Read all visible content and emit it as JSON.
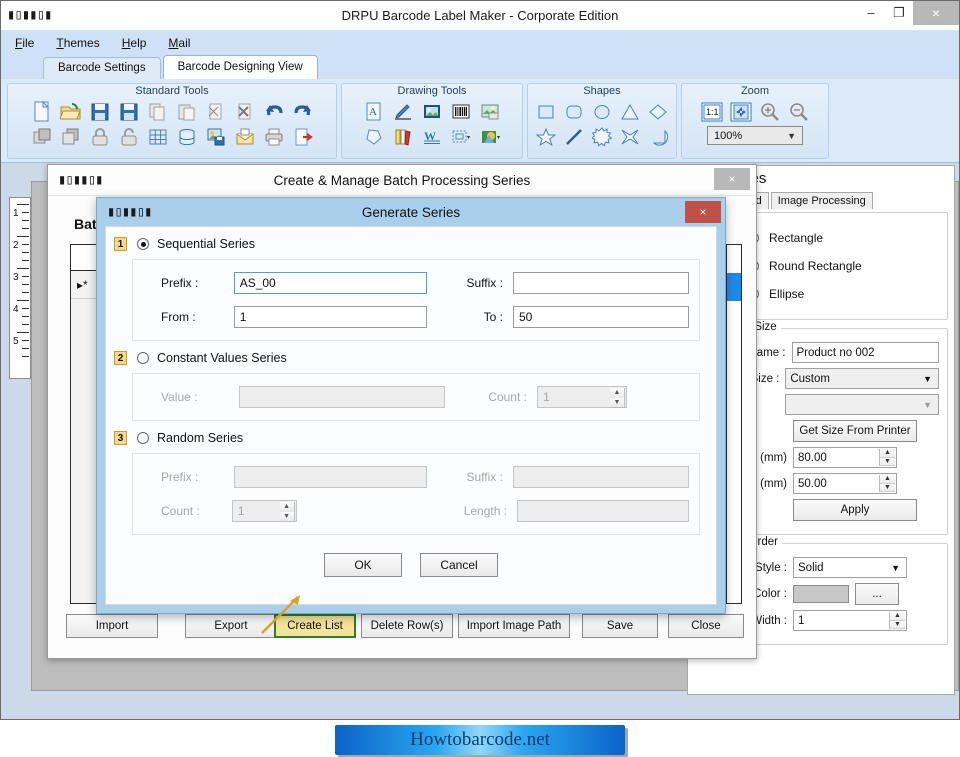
{
  "window": {
    "title": "DRPU Barcode Label Maker - Corporate Edition",
    "icon": "barcode-icon",
    "minimize": "–",
    "maximize": "❐",
    "close": "×"
  },
  "menubar": {
    "items": [
      "File",
      "Themes",
      "Help",
      "Mail"
    ]
  },
  "tabs": [
    {
      "label": "Barcode Settings",
      "active": false
    },
    {
      "label": "Barcode Designing View",
      "active": true
    }
  ],
  "ribbon": {
    "groups": [
      {
        "title": "Standard Tools",
        "row1": [
          "new-document-icon",
          "open-folder-icon",
          "save-icon",
          "save-as-icon",
          "copy-icon",
          "paste-icon",
          "cut-icon",
          "delete-icon",
          "undo-icon",
          "redo-icon"
        ],
        "row2": [
          "bring-forward-icon",
          "send-backward-icon",
          "lock-icon",
          "unlock-icon",
          "grid-icon",
          "database-icon",
          "batch-processing-icon",
          "email-icon",
          "print-icon",
          "export-icon"
        ]
      },
      {
        "title": "Drawing Tools",
        "row1": [
          "text-icon",
          "pencil-icon",
          "picture-icon",
          "barcode-icon",
          "watermark-icon"
        ],
        "row2": [
          "shape-icon",
          "library-icon",
          "signature-icon",
          "frame-icon",
          "clipart-icon"
        ]
      },
      {
        "title": "Shapes",
        "row1": [
          "square-icon",
          "round-rect-icon",
          "ellipse-icon",
          "triangle-icon",
          "diamond-icon"
        ],
        "row2": [
          "star-icon",
          "line-icon",
          "burst-icon",
          "four-point-star-icon",
          "pie-icon"
        ]
      },
      {
        "title": "Zoom",
        "row1": [
          "actual-size-icon",
          "fit-to-window-icon",
          "zoom-in-icon",
          "zoom-out-icon"
        ],
        "zoom_value": "100%"
      }
    ]
  },
  "ruler": {
    "marks": [
      "1",
      "2",
      "3",
      "4",
      "5"
    ]
  },
  "properties_panel": {
    "title": "Properties",
    "tabs": [
      "Background",
      "Image Processing"
    ],
    "shape_group": {
      "options": [
        {
          "label": "Rectangle",
          "selected": false
        },
        {
          "label": "Round Rectangle",
          "selected": true
        },
        {
          "label": "Ellipse",
          "selected": false
        }
      ]
    },
    "shape_size_group": {
      "legend": "Shape & Size",
      "name_label": "Name :",
      "name_value": "Product no 002",
      "size_label": "Size :",
      "size_value": "Custom",
      "paper_value": "",
      "get_size_button": "Get Size From Printer",
      "width_label": "Width (mm)",
      "width_value": "80.00",
      "height_label": "Height (mm)",
      "height_value": "50.00",
      "apply_button": "Apply"
    },
    "border_group": {
      "legend": "Shape Border",
      "style_label": "Style :",
      "style_value": "Solid",
      "color_label": "Color :",
      "color_swatch": "#c8c8c8",
      "color_browse": "...",
      "width_label": "Border Width :",
      "width_value": "1"
    }
  },
  "batch_dialog": {
    "title": "Create & Manage Batch Processing Series",
    "icon": "barcode-icon",
    "close": "×",
    "heading": "Batch",
    "grid_row_marker": "▸*",
    "footer_buttons": [
      {
        "label": "Import",
        "highlighted": false
      },
      {
        "label": "Export",
        "highlighted": false
      },
      {
        "label": "Create List",
        "highlighted": true
      },
      {
        "label": "Delete Row(s)",
        "highlighted": false
      },
      {
        "label": "Import Image Path",
        "highlighted": false
      },
      {
        "label": "Save",
        "highlighted": false
      },
      {
        "label": "Close",
        "highlighted": false
      }
    ]
  },
  "generate_dialog": {
    "title": "Generate Series",
    "icon": "barcode-icon",
    "close": "×",
    "sections": [
      {
        "number": "1",
        "label": "Sequential Series",
        "selected": true,
        "enabled": true,
        "fields": {
          "prefix_label": "Prefix :",
          "prefix_value": "AS_00",
          "suffix_label": "Suffix :",
          "suffix_value": "",
          "from_label": "From :",
          "from_value": "1",
          "to_label": "To :",
          "to_value": "50"
        }
      },
      {
        "number": "2",
        "label": "Constant Values Series",
        "selected": false,
        "enabled": false,
        "fields": {
          "value_label": "Value :",
          "value_value": "",
          "count_label": "Count :",
          "count_value": "1"
        }
      },
      {
        "number": "3",
        "label": "Random Series",
        "selected": false,
        "enabled": false,
        "fields": {
          "prefix_label": "Prefix :",
          "prefix_value": "",
          "suffix_label": "Suffix :",
          "suffix_value": "",
          "count_label": "Count :",
          "count_value": "1",
          "length_label": "Length :",
          "length_value": ""
        }
      }
    ],
    "ok_button": "OK",
    "cancel_button": "Cancel"
  },
  "footer_banner": {
    "text": "Howtobarcode.net"
  },
  "colors": {
    "title_blue": "#cfe1f5",
    "dialog_blue": "#a9cfeb",
    "close_red": "#c0504a",
    "highlight_yellow": "#f3e39b",
    "number_tag": "#f5d98e",
    "arrow": "#d8a526",
    "scroll_thumb": "#1e8ae8"
  }
}
